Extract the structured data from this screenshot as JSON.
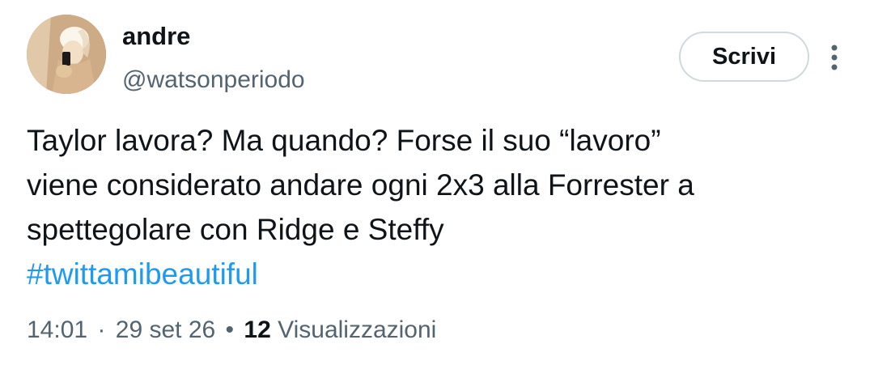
{
  "author": {
    "display_name": "andre",
    "handle": "@watsonperiodo",
    "avatar_icon": "profile-photo"
  },
  "actions": {
    "write_label": "Scrivi",
    "more_icon": "vertical-ellipsis-icon"
  },
  "tweet": {
    "lines": [
      "Taylor lavora? Ma quando? Forse il suo “lavoro”",
      "viene considerato andare ogni 2x3 alla Forrester a",
      "spettegolare con Ridge e Steffy"
    ],
    "hashtag": "#twittamibeautiful"
  },
  "meta": {
    "time": "14:01",
    "separator": "·",
    "date": "29 set 26",
    "separator_bold": "•",
    "views_count": "12",
    "views_label": "Visualizzazioni"
  },
  "colors": {
    "text_primary": "#0f1419",
    "text_secondary": "#536471",
    "link": "#1d9bf0",
    "button_border": "#cfd9de"
  }
}
